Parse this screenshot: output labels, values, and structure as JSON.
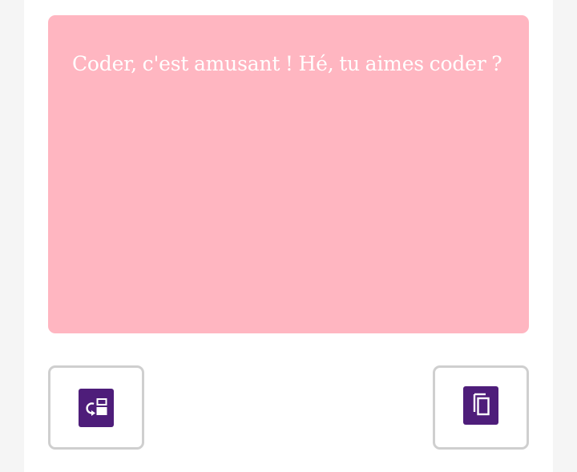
{
  "output": {
    "text": "Coder, c'est amusant ! Hé, tu aimes coder ?",
    "background_color": "#ffb6c1",
    "text_color": "#ffffff"
  },
  "actions": [
    {
      "name": "swap-icon",
      "color": "#4e1d7a"
    },
    {
      "name": "copy-icon",
      "color": "#4e1d7a"
    }
  ]
}
